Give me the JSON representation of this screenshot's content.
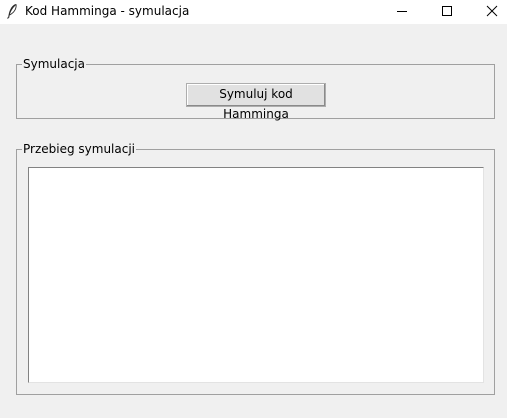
{
  "window": {
    "title": "Kod Hamminga - symulacja",
    "icon": "feather-icon",
    "controls": [
      "minimize-icon",
      "maximize-icon",
      "close-icon"
    ]
  },
  "simulation_group": {
    "label": "Symulacja",
    "button_label": "Symuluj kod Hamminga"
  },
  "log_group": {
    "label": "Przebieg symulacji",
    "content": ""
  },
  "colors": {
    "window_bg": "#f0f0f0",
    "titlebar_bg": "#ffffff",
    "group_border": "#a0a0a0",
    "button_bg": "#e1e1e1",
    "text_area_bg": "#ffffff"
  }
}
